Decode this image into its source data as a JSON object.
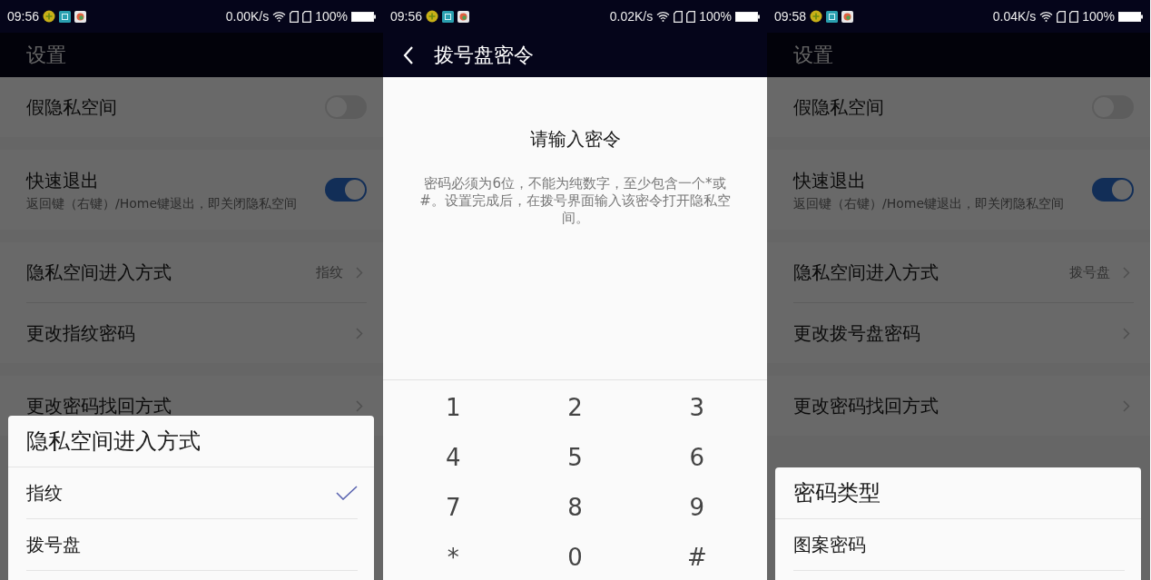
{
  "panels": [
    {
      "kind": "settings",
      "status_bar": {
        "time": "09:56",
        "speed": "0.00K/s",
        "battery": "100%"
      },
      "title": "设置",
      "groups": [
        [
          {
            "kind": "toggle",
            "label": "假隐私空间",
            "on": false
          }
        ],
        [
          {
            "kind": "toggle",
            "label": "快速退出",
            "subtitle": "返回键（右键）/Home键退出，即关闭隐私空间",
            "on": true
          }
        ],
        [
          {
            "kind": "link",
            "label": "隐私空间进入方式",
            "value": "指纹"
          },
          {
            "kind": "link",
            "label": "更改指纹密码"
          }
        ],
        [
          {
            "kind": "link",
            "label": "更改密码找回方式"
          }
        ]
      ],
      "dialog": {
        "title": "隐私空间进入方式",
        "options": [
          {
            "label": "指纹",
            "selected": true
          },
          {
            "label": "拨号盘",
            "selected": false
          }
        ]
      }
    },
    {
      "kind": "dialpad",
      "status_bar": {
        "time": "09:56",
        "speed": "0.02K/s",
        "battery": "100%"
      },
      "title": "拨号盘密令",
      "heading": "请输入密令",
      "description": "密码必须为6位，不能为纯数字，至少包含一个*或#。设置完成后，在拨号界面输入该密令打开隐私空间。",
      "keys": [
        "1",
        "2",
        "3",
        "4",
        "5",
        "6",
        "7",
        "8",
        "9",
        "*",
        "0",
        "#"
      ]
    },
    {
      "kind": "settings",
      "status_bar": {
        "time": "09:58",
        "speed": "0.04K/s",
        "battery": "100%"
      },
      "title": "设置",
      "groups": [
        [
          {
            "kind": "toggle",
            "label": "假隐私空间",
            "on": false
          }
        ],
        [
          {
            "kind": "toggle",
            "label": "快速退出",
            "subtitle": "返回键（右键）/Home键退出，即关闭隐私空间",
            "on": true
          }
        ],
        [
          {
            "kind": "link",
            "label": "隐私空间进入方式",
            "value": "拨号盘"
          },
          {
            "kind": "link",
            "label": "更改拨号盘密码"
          }
        ],
        [
          {
            "kind": "link",
            "label": "更改密码找回方式"
          }
        ]
      ],
      "dialog": {
        "title": "密码类型",
        "options": [
          {
            "label": "图案密码",
            "selected": false
          }
        ]
      }
    }
  ]
}
